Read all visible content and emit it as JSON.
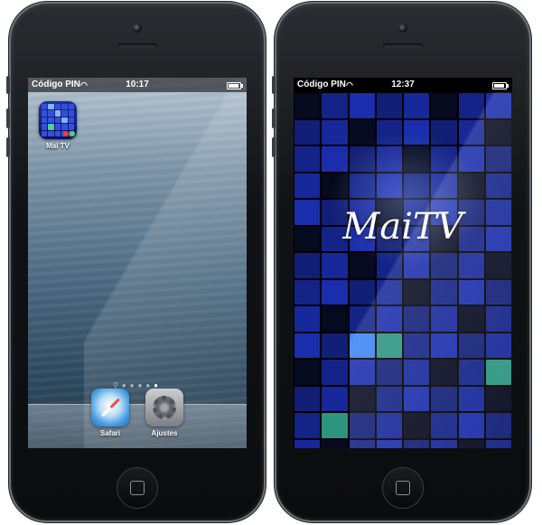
{
  "left_phone": {
    "status": {
      "carrier": "Código PIN",
      "time": "10:17",
      "battery_level": 0.9
    },
    "apps": [
      {
        "label": "Mai TV",
        "icon": "maitv-icon"
      }
    ],
    "page_dots": {
      "count": 5,
      "active": 5
    },
    "dock": [
      {
        "label": "Safari",
        "icon": "safari-compass-icon"
      },
      {
        "label": "Ajustes",
        "icon": "settings-gear-icon"
      }
    ]
  },
  "right_phone": {
    "status": {
      "carrier": "Código PIN",
      "time": "12:37",
      "battery_level": 0.9
    },
    "app_title": "MaiTV",
    "colors": {
      "tile_blue": "#1b2fb5",
      "tile_dark": "#0b1238",
      "tile_cyan": "#3f8bff",
      "tile_teal": "#2e9c86"
    }
  }
}
